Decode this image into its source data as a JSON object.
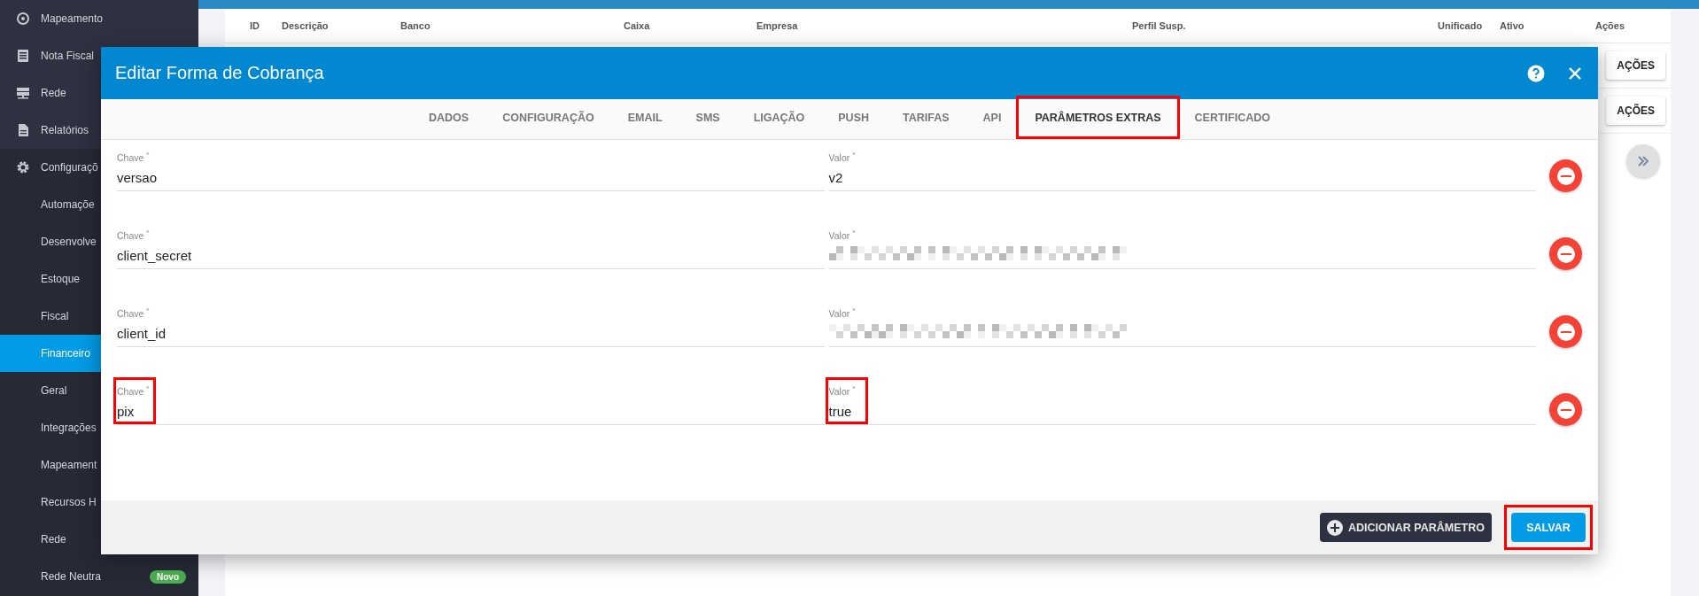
{
  "sidebar": {
    "groups": [
      {
        "items": [
          {
            "label": "Mapeamento",
            "kind": "section",
            "selected": false
          },
          {
            "label": "Nota Fiscal",
            "kind": "section",
            "selected": false
          },
          {
            "label": "Rede",
            "kind": "section",
            "selected": false
          },
          {
            "label": "Relatórios",
            "kind": "section",
            "selected": false
          }
        ]
      },
      {
        "items": [
          {
            "label": "Configuraçõ",
            "kind": "section",
            "selected": false
          },
          {
            "label": "Automaçõe",
            "kind": "subitem",
            "selected": false
          },
          {
            "label": "Desenvolve",
            "kind": "subitem",
            "selected": false
          },
          {
            "label": "Estoque",
            "kind": "subitem",
            "selected": false
          },
          {
            "label": "Fiscal",
            "kind": "subitem",
            "selected": false
          },
          {
            "label": "Financeiro",
            "kind": "subitem",
            "selected": true
          },
          {
            "label": "Geral",
            "kind": "subitem",
            "selected": false
          },
          {
            "label": "Integrações",
            "kind": "subitem",
            "selected": false
          },
          {
            "label": "Mapeament",
            "kind": "subitem",
            "selected": false
          },
          {
            "label": "Recursos H",
            "kind": "subitem",
            "selected": false
          },
          {
            "label": "Rede",
            "kind": "subitem",
            "selected": false
          },
          {
            "label": "Rede Neutra",
            "kind": "subitem",
            "selected": false,
            "badge": "Novo"
          }
        ]
      }
    ]
  },
  "table": {
    "columns": [
      "ID",
      "Descrição",
      "Banco",
      "Caixa",
      "Empresa",
      "Perfil Susp.",
      "Unificado",
      "Ativo",
      "Ações"
    ],
    "row_actions": [
      "AÇÕES",
      "AÇÕES"
    ]
  },
  "dialog": {
    "title": "Editar Forma de Cobrança",
    "tabs": [
      {
        "label": "DADOS",
        "selected": false,
        "highlighted": false
      },
      {
        "label": "CONFIGURAÇÃO",
        "selected": false,
        "highlighted": false
      },
      {
        "label": "EMAIL",
        "selected": false,
        "highlighted": false
      },
      {
        "label": "SMS",
        "selected": false,
        "highlighted": false
      },
      {
        "label": "LIGAÇÃO",
        "selected": false,
        "highlighted": false
      },
      {
        "label": "PUSH",
        "selected": false,
        "highlighted": false
      },
      {
        "label": "TARIFAS",
        "selected": false,
        "highlighted": false
      },
      {
        "label": "API",
        "selected": false,
        "highlighted": false
      },
      {
        "label": "PARÂMETROS EXTRAS",
        "selected": true,
        "highlighted": true
      },
      {
        "label": "CERTIFICADO",
        "selected": false,
        "highlighted": false
      }
    ],
    "params": [
      {
        "key": {
          "label": "Chave $^{*}$",
          "value": "versao",
          "highlighted": false
        },
        "value": {
          "label": "Valor $^{*}$",
          "value": "v2",
          "pixelated": false,
          "highlighted": false
        }
      },
      {
        "key": {
          "label": "Chave $^{*}$",
          "value": "client_secret",
          "highlighted": false
        },
        "value": {
          "label": "Valor $^{*}$",
          "pixelated": true,
          "highlighted": false
        }
      },
      {
        "key": {
          "label": "Chave $^{*}$",
          "value": "client_id",
          "highlighted": false
        },
        "value": {
          "label": "Valor $^{*}$",
          "pixelated": true,
          "highlighted": false
        }
      },
      {
        "key": {
          "label": "Chave $^{*}$",
          "value": "pix",
          "highlighted": true
        },
        "value": {
          "label": "Valor $^{*}$",
          "value": "true",
          "pixelated": false,
          "highlighted": true
        }
      }
    ],
    "add_button": "ADICIONAR PARÂMETRO",
    "save_button": {
      "label": "SALVAR",
      "highlighted": true
    }
  }
}
